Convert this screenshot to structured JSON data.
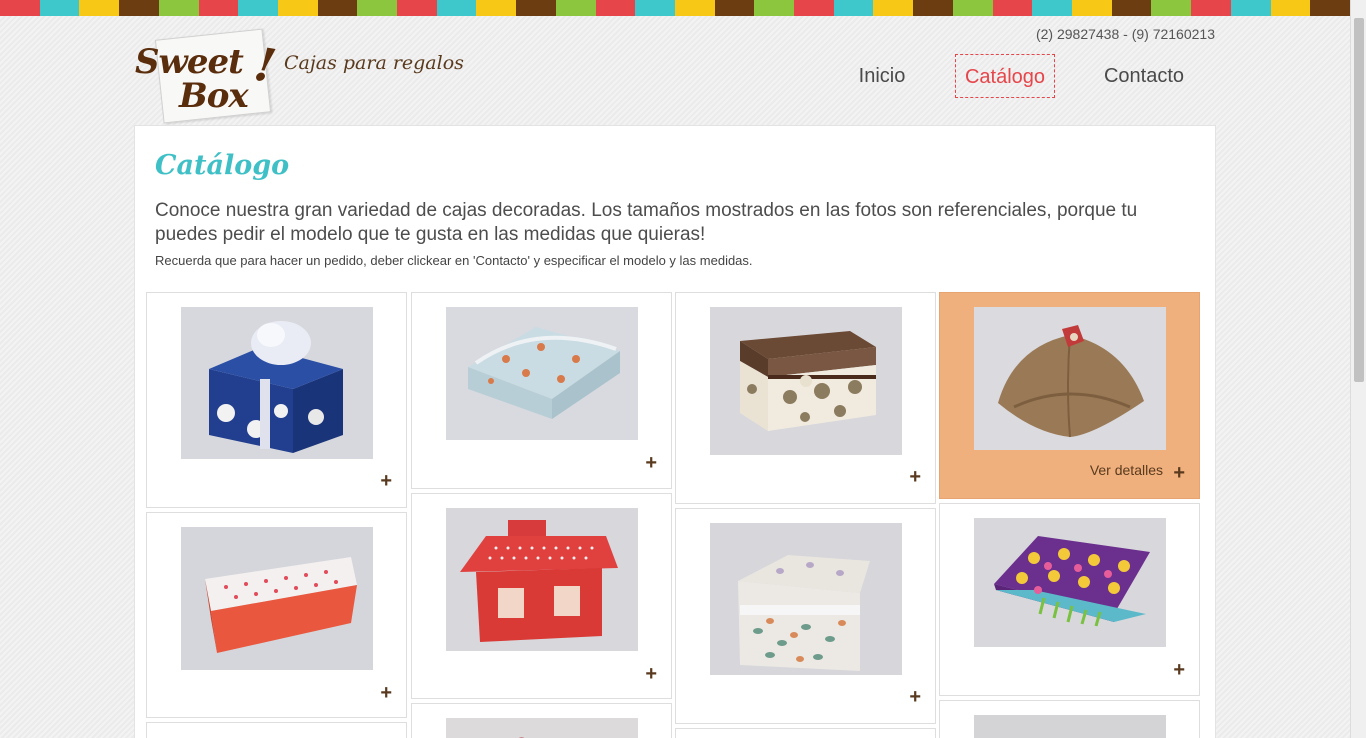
{
  "colors": {
    "stripe": [
      "#e6454a",
      "#3fc8cc",
      "#f7c815",
      "#6b3d10",
      "#8cc63f"
    ],
    "accent_red": "#e6454a",
    "title_teal": "#3fc0c6",
    "brand_brown": "#5a2d0c",
    "active_card": "#f0b07d"
  },
  "header": {
    "logo_word1": "Sweet",
    "logo_word2": "Box",
    "logo_mark": "!",
    "tagline": "Cajas para regalos",
    "phone": "(2) 29827438 - (9) 72160213"
  },
  "nav": {
    "inicio": "Inicio",
    "catalogo": "Catálogo",
    "contacto": "Contacto"
  },
  "catalog": {
    "title": "Catálogo",
    "intro": "Conoce nuestra gran variedad de cajas decoradas. Los tamaños mostrados en las fotos son referenciales, porque tu puedes pedir el modelo que te gusta en las medidas que quieras!",
    "note": "Recuerda que para hacer un pedido, deber clickear en 'Contacto' y especificar el modelo y las medidas.",
    "plus_icon": "+",
    "details_label": "Ver detalles",
    "items": [
      {
        "photo": "blue-polka-box-with-ribbon"
      },
      {
        "photo": "blue-floral-flat-box"
      },
      {
        "photo": "brown-damask-box-with-bow"
      },
      {
        "photo": "kraft-pillow-box",
        "state": "hover"
      },
      {
        "photo": "red-heart-rectangular-box"
      },
      {
        "photo": "red-house-box"
      },
      {
        "photo": "leaf-pattern-box-with-lace"
      },
      {
        "photo": "purple-circles-box"
      }
    ]
  }
}
